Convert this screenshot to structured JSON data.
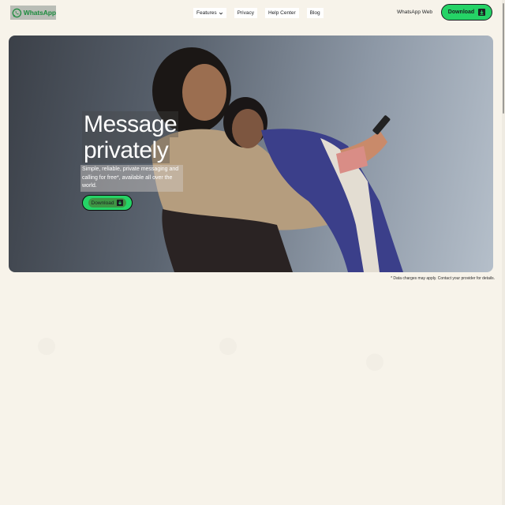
{
  "header": {
    "logo_text": "WhatsApp",
    "nav": [
      {
        "label": "Features",
        "has_dropdown": true
      },
      {
        "label": "Privacy"
      },
      {
        "label": "Help Center"
      },
      {
        "label": "Blog"
      }
    ],
    "web_link": "WhatsApp Web",
    "download_label": "Download"
  },
  "hero": {
    "title_line1": "Message",
    "title_line2": "privately",
    "subtitle": "Simple, reliable, private messaging and calling for free*, available all over the world.",
    "download_label": "Download"
  },
  "footnote": "* Data charges may apply. Contact your provider for details.",
  "colors": {
    "brand_green": "#25d366",
    "logo_green": "#1d8b3e",
    "page_bg": "#f7f3ea"
  },
  "icons": [
    "whatsapp-logo-icon",
    "chevron-down-icon",
    "download-icon"
  ]
}
